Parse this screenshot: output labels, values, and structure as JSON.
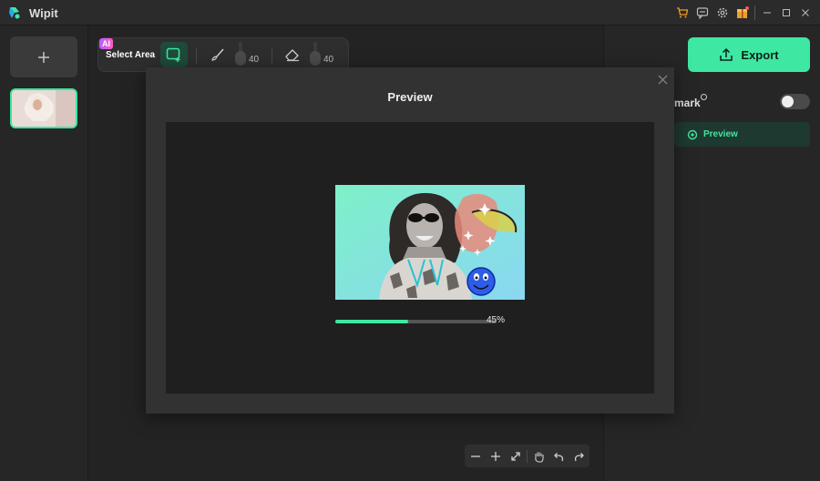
{
  "app": {
    "title": "Wipit"
  },
  "toolbar": {
    "ai_badge": "AI",
    "select_area_label": "Select Area",
    "brush_value": "40",
    "eraser_value": "40"
  },
  "export": {
    "label": "Export"
  },
  "right_panel": {
    "watermark_label": "mark",
    "watermark_enabled": false,
    "preview_label": "Preview"
  },
  "modal": {
    "title": "Preview",
    "progress_percent": 45,
    "progress_label": "45%"
  },
  "colors": {
    "accent": "#3ee8a2",
    "accent_dark": "#1e3a30",
    "background": "#232323",
    "panel": "#2b2b2b"
  },
  "icons": {
    "titlebar": [
      "cart-icon",
      "feedback-icon",
      "settings-icon",
      "gift-icon"
    ],
    "window": [
      "minimize-icon",
      "maximize-icon",
      "close-icon"
    ],
    "zoom": [
      "zoom-out-icon",
      "zoom-in-icon",
      "fit-icon",
      "hand-icon",
      "undo-icon",
      "redo-icon"
    ]
  }
}
